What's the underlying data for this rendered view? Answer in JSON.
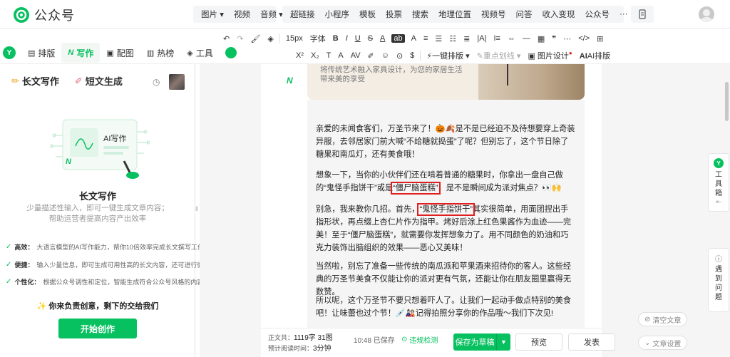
{
  "header": {
    "brand": "公众号",
    "menu1": [
      "图片",
      "视频",
      "音频"
    ],
    "menu2": [
      "超链接",
      "小程序",
      "模板",
      "投票",
      "搜索",
      "地理位置",
      "视频号",
      "问答",
      "收入变现",
      "公众号"
    ],
    "more": "···"
  },
  "left_tabs": [
    {
      "label": "排版"
    },
    {
      "label": "写作"
    },
    {
      "label": "配图"
    },
    {
      "label": "热榜"
    },
    {
      "label": "工具"
    }
  ],
  "toolbar": {
    "row1": [
      "↶",
      "↷",
      "🖌",
      "◈",
      "Tt",
      "15px",
      "字体",
      "B",
      "I",
      "U",
      "S",
      "A",
      "ab",
      "A",
      "≡",
      "☰",
      "☷",
      "≣",
      "|A|",
      "I≡",
      "⇔",
      "—",
      "▦",
      "❞",
      "⋯",
      "</>",
      "⊞"
    ],
    "row2": [
      "X²",
      "X₂",
      "T",
      "A",
      "AV",
      "✐",
      "☺",
      "⊙",
      "$",
      "一键排版",
      "重点划线",
      "图片设计",
      "AI排版"
    ]
  },
  "left_panel": {
    "tab_long": "长文写作",
    "tab_short": "短文生成",
    "illus_title": "AI写作",
    "title": "长文写作",
    "desc1": "少量描述性输入，即可一键生成文章内容；",
    "desc2": "帮助运营者提高内容产出效率",
    "features": [
      {
        "k": "高效：",
        "v": "大语言模型的AI写作能力，帮你10倍效率完成长文撰写工作"
      },
      {
        "k": "便捷：",
        "v": "输入少量信息，即可生成可用性高的长文内容，还可进行微调"
      },
      {
        "k": "个性化：",
        "v": "根据公众号调性和定位，智能生成符合公众号风格的内容"
      }
    ],
    "slogan": "✨ 你来负责创意，剩下的交给我们",
    "start_btn": "开始创作"
  },
  "editor": {
    "img_caption": "将传统艺术融入家具设计，为您的家居生活带来美的享受",
    "p1": "亲爱的未闻食客们，万圣节来了！🎃🍂是不是已经迫不及待想要穿上奇装异服，去邻居家门前大喊“不给糖就捣蛋”了呢？但别忘了，这个节日除了糖果和南瓜灯，还有美食哦！",
    "p2_a": "想象一下，当你的小伙伴们还在啃着普通的糖果时，你拿出一盘自己做的“鬼怪手指饼干”或是",
    "p2_mark": "“僵尸脑蛋糕”",
    "p2_b": "，是不是瞬间成为派对焦点？👀🙌",
    "p3_a": "别急，我来教你几招。首先，",
    "p3_mark": "“鬼怪手指饼干”",
    "p3_b": "其实很简单，用面团捏出手指形状，再点缀上杏仁片作为指甲。烤好后涂上红色果酱作为血迹——完美！至于“僵尸脑蛋糕”，就需要你发挥想象力了。用不同颜色的奶油和巧克力装饰出脑组织的效果——恶心又美味！",
    "p4": "当然啦，别忘了准备一些传统的南瓜派和苹果酒来招待你的客人。这些经典的万圣节美食不仅能让你的派对更有气氛，还能让你在朋友圈里赢得无数赞。",
    "p5": "所以呢，这个万圣节不要只想着吓人了。让我们一起动手做点特别的美食吧！让味蕾也过个节！💉🎎记得拍照分享你的作品哦～我们下次见!"
  },
  "footer": {
    "label_count": "正文共：",
    "count": "1119字 31图",
    "label_read": "预计阅读时间：",
    "read": "3分钟",
    "saved": "10:48 已保存",
    "check": "违规检测",
    "save": "保存为草稿",
    "preview": "预览",
    "publish": "发表"
  },
  "right": {
    "toolbox": [
      "工",
      "具",
      "箱"
    ],
    "feedback": [
      "遇",
      "到",
      "问",
      "题"
    ],
    "clear": "清空文章",
    "settings": "文章设置"
  },
  "colors": {
    "accent": "#07c160",
    "highlight": "#e02020"
  }
}
